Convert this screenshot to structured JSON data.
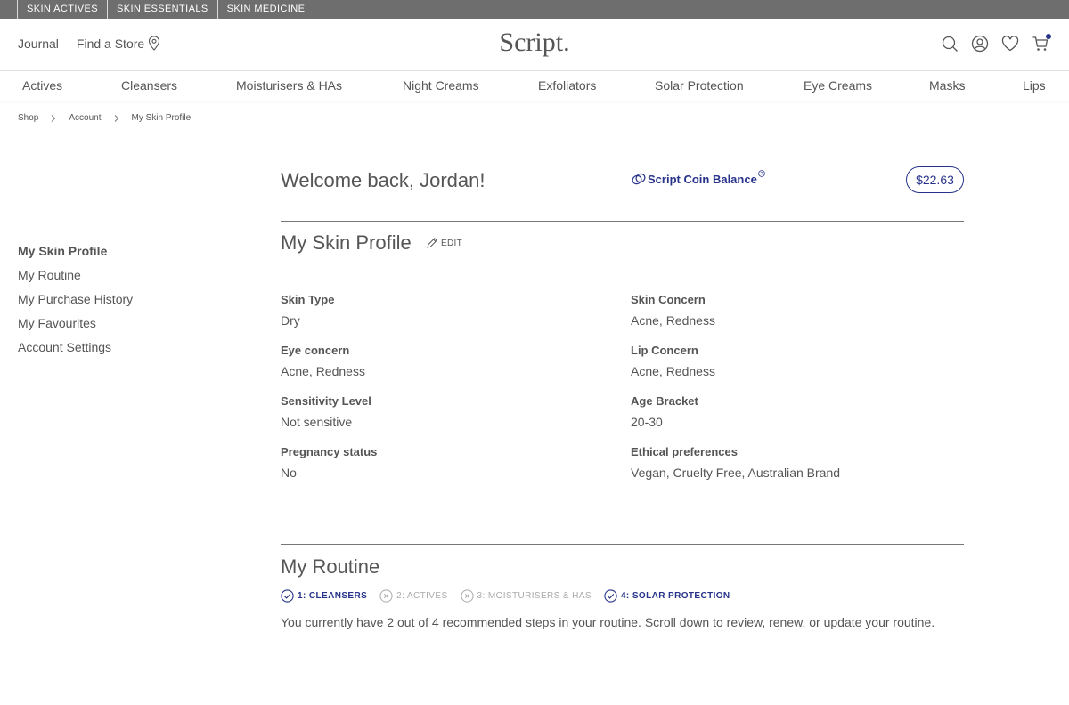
{
  "brand_tabs": [
    "SKIN ACTIVES",
    "SKIN ESSENTIALS",
    "SKIN MEDICINE"
  ],
  "header": {
    "journal": "Journal",
    "find_store": "Find a Store",
    "logo": "Script.",
    "icons": [
      "search-icon",
      "account-icon",
      "heart-icon",
      "cart-icon"
    ],
    "accent_color": "#27338a"
  },
  "categories": [
    "Actives",
    "Cleansers",
    "Moisturisers & HAs",
    "Night Creams",
    "Exfoliators",
    "Solar Protection",
    "Eye Creams",
    "Masks",
    "Lips"
  ],
  "breadcrumb": [
    "Shop",
    "Account",
    "My Skin Profile"
  ],
  "sidebar": {
    "items": [
      "My Skin Profile",
      "My Routine",
      "My Purchase History",
      "My Favourites",
      "Account Settings"
    ],
    "active": "My Skin Profile"
  },
  "welcome": "Welcome back, Jordan!",
  "coin": {
    "label": "Script Coin Balance",
    "info": "?",
    "balance": "$22.63"
  },
  "profile": {
    "title": "My Skin Profile",
    "edit": "EDIT",
    "fields": [
      {
        "label": "Skin Type",
        "value": "Dry"
      },
      {
        "label": "Skin Concern",
        "value": "Acne, Redness"
      },
      {
        "label": "Eye concern",
        "value": "Acne, Redness"
      },
      {
        "label": "Lip Concern",
        "value": "Acne, Redness"
      },
      {
        "label": "Sensitivity Level",
        "value": "Not sensitive"
      },
      {
        "label": "Age Bracket",
        "value": "20-30"
      },
      {
        "label": "Pregnancy status",
        "value": "No"
      },
      {
        "label": "Ethical preferences",
        "value": "Vegan, Cruelty Free, Australian Brand"
      }
    ]
  },
  "routine": {
    "title": "My Routine",
    "steps": [
      {
        "label": "1: CLEANSERS",
        "status": "done"
      },
      {
        "label": "2: ACTIVES",
        "status": "todo"
      },
      {
        "label": "3: MOISTURISERS & HAS",
        "status": "todo"
      },
      {
        "label": "4: SOLAR PROTECTION",
        "status": "done"
      }
    ],
    "text": "You currently have 2 out of 4 recommended steps in your routine. Scroll down to review, renew, or update your routine."
  }
}
